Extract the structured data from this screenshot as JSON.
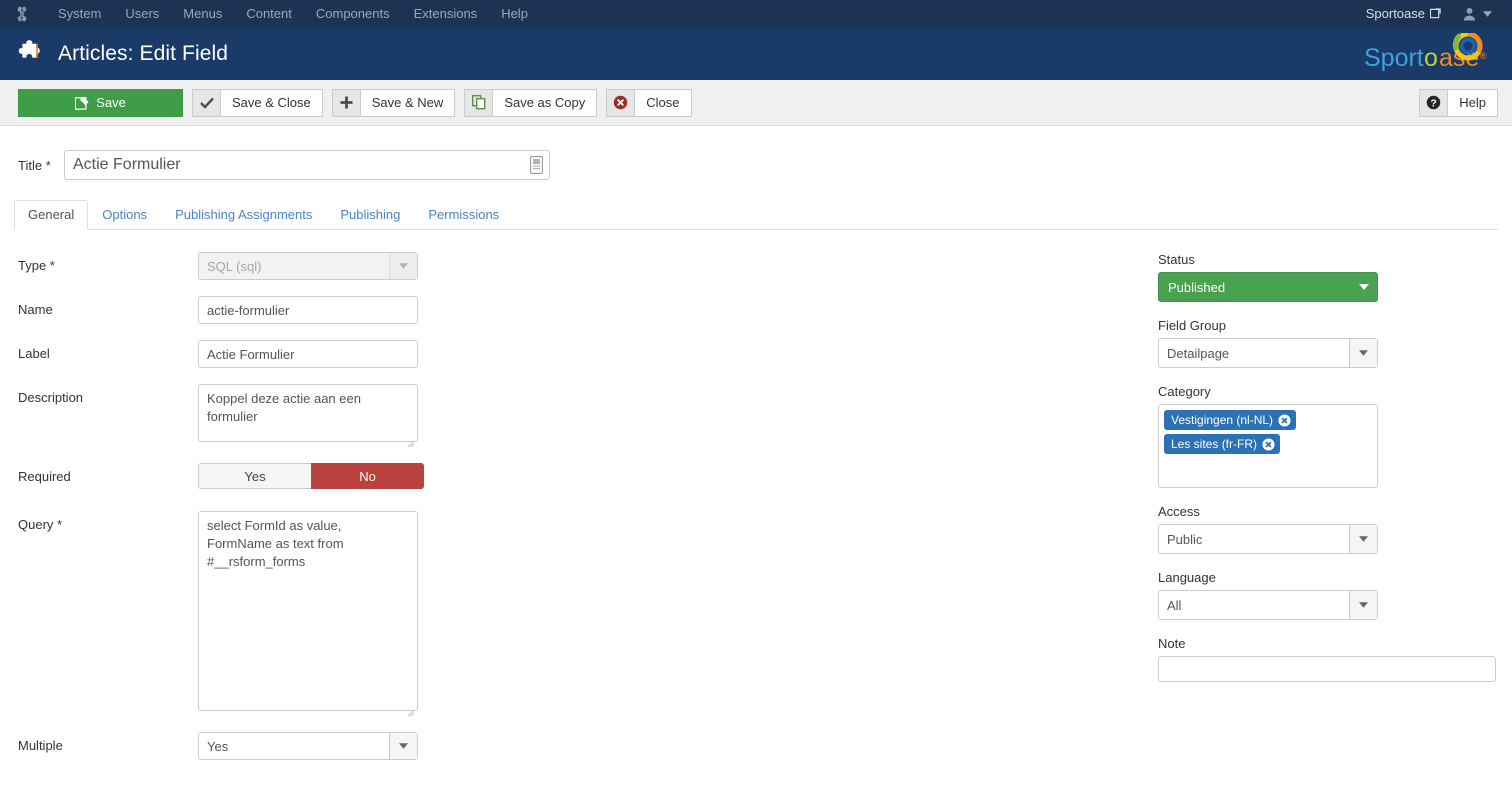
{
  "admin_bar": {
    "logo_icon": "joomla-logo-icon",
    "menu": [
      {
        "label": "System"
      },
      {
        "label": "Users"
      },
      {
        "label": "Menus"
      },
      {
        "label": "Content"
      },
      {
        "label": "Components"
      },
      {
        "label": "Extensions"
      },
      {
        "label": "Help"
      }
    ],
    "site_name": "Sportoase",
    "site_icon": "external-link-icon",
    "user_icon": "user-icon",
    "user_caret_icon": "caret-down-icon"
  },
  "header": {
    "title": "Articles: Edit Field",
    "icon": "puzzle-piece-icon",
    "brand": {
      "text_part1": "Sport",
      "text_part2": "o",
      "text_part3": "ase",
      "registered": "®",
      "ring_icon": "sportoase-ring-icon"
    }
  },
  "toolbar": {
    "buttons": [
      {
        "label": "Save",
        "icon": "save-pencil-icon",
        "style": "primary"
      },
      {
        "label": "Save & Close",
        "icon": "check-icon",
        "style": "default"
      },
      {
        "label": "Save & New",
        "icon": "plus-icon",
        "style": "default"
      },
      {
        "label": "Save as Copy",
        "icon": "copy-icon",
        "style": "default"
      },
      {
        "label": "Close",
        "icon": "cancel-circle-icon",
        "style": "default"
      }
    ],
    "help": {
      "label": "Help",
      "icon": "question-circle-icon"
    }
  },
  "title_field": {
    "label": "Title *",
    "value": "Actie Formulier",
    "placeholder": "",
    "trailing_icon": "article-id-icon"
  },
  "tabs": [
    {
      "label": "General",
      "active": true
    },
    {
      "label": "Options",
      "active": false
    },
    {
      "label": "Publishing Assignments",
      "active": false
    },
    {
      "label": "Publishing",
      "active": false
    },
    {
      "label": "Permissions",
      "active": false
    }
  ],
  "left_form": {
    "type": {
      "label": "Type *",
      "value": "SQL (sql)",
      "disabled": true,
      "arrow_icon": "caret-down-icon"
    },
    "name": {
      "label": "Name",
      "value": "actie-formulier"
    },
    "field_label": {
      "label": "Label",
      "value": "Actie Formulier"
    },
    "description": {
      "label": "Description",
      "value": "Koppel deze actie aan een formulier",
      "resize_icon": "resize-handle-icon"
    },
    "required": {
      "label": "Required",
      "options": [
        "Yes",
        "No"
      ],
      "selected": "No"
    },
    "query": {
      "label": "Query *",
      "value": "select FormId as value, FormName as text from #__rsform_forms",
      "resize_icon": "resize-handle-icon"
    },
    "multiple": {
      "label": "Multiple",
      "value": "Yes",
      "arrow_icon": "caret-down-icon"
    }
  },
  "right_form": {
    "status": {
      "label": "Status",
      "value": "Published",
      "color": "#4aa14f",
      "arrow_icon": "caret-down-icon"
    },
    "field_group": {
      "label": "Field Group",
      "value": "Detailpage",
      "arrow_icon": "caret-down-icon"
    },
    "category": {
      "label": "Category",
      "tags": [
        {
          "label": "Vestigingen (nl-NL)",
          "remove_icon": "remove-tag-icon"
        },
        {
          "label": "Les sites (fr-FR)",
          "remove_icon": "remove-tag-icon"
        }
      ],
      "tag_color": "#2b72b4"
    },
    "access": {
      "label": "Access",
      "value": "Public",
      "arrow_icon": "caret-down-icon"
    },
    "language": {
      "label": "Language",
      "value": "All",
      "arrow_icon": "caret-down-icon"
    },
    "note": {
      "label": "Note",
      "value": "",
      "placeholder": ""
    }
  },
  "colors": {
    "admin_bar_bg": "#1c3353",
    "header_bg": "#1a3a68",
    "toolbar_bg": "#f0f0f0",
    "save_green": "#3f9c47",
    "status_green": "#4aa14f",
    "danger_red": "#b8413b",
    "tag_blue": "#2b72b4",
    "link_blue": "#4a84c4"
  }
}
